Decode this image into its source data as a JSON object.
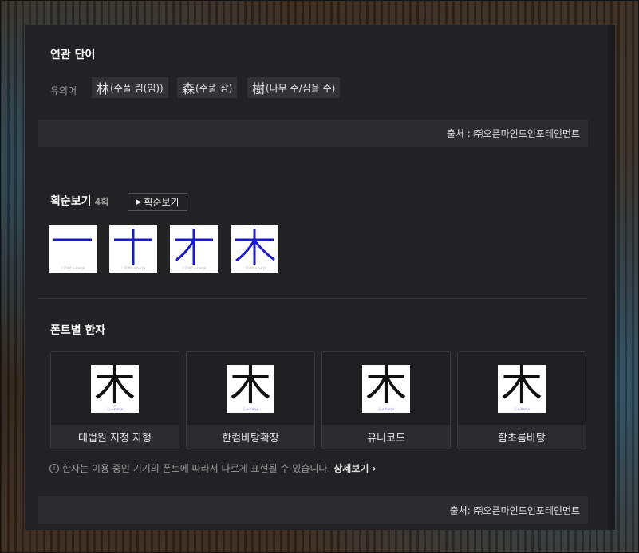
{
  "related": {
    "title": "연관 단어",
    "synonym_label": "유의어",
    "synonyms": [
      {
        "hanja": "林",
        "reading": "(수풀 림(임))"
      },
      {
        "hanja": "森",
        "reading": "(수풀 삼)"
      },
      {
        "hanja": "樹",
        "reading": "(나무 수/심을 수)"
      }
    ],
    "source": "출처 : ㈜오픈마인드인포테인먼트"
  },
  "stroke_order": {
    "title": "획순보기",
    "count": "4획",
    "button_label": "획순보기",
    "copyright": "ⓒ2000 e-hanja",
    "frames": [
      1,
      2,
      3,
      4
    ]
  },
  "fonts": {
    "title": "폰트별 한자",
    "character": "木",
    "brand": "ⓒ e-hanja",
    "cards": [
      {
        "name": "대법원 지정 자형"
      },
      {
        "name": "한컴바탕확장"
      },
      {
        "name": "유니코드"
      },
      {
        "name": "함초롬바탕"
      }
    ],
    "notice": "한자는 이용 중인 기기의 폰트에 따라서 다르게 표현될 수 있습니다.",
    "more_label": "상세보기",
    "source": "출처: ㈜오픈마인드인포테인먼트"
  },
  "colors": {
    "stroke": "#1a1acc",
    "panel": "#222225"
  }
}
